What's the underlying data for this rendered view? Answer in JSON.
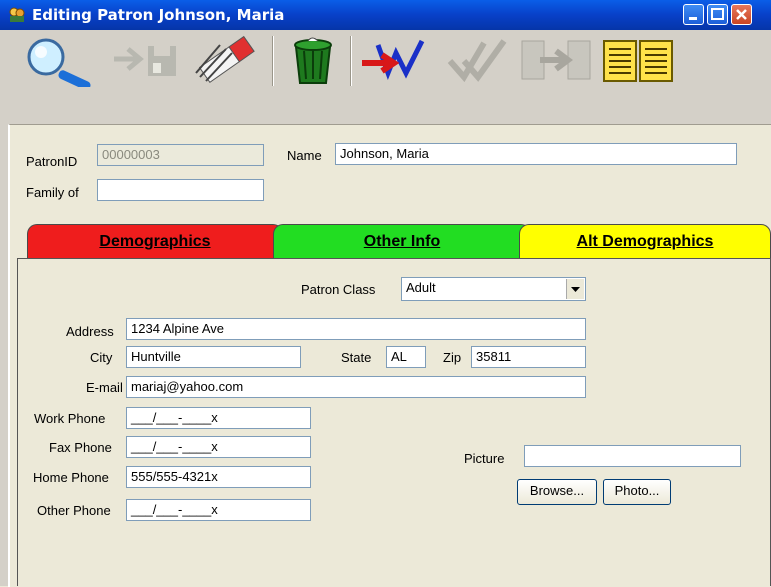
{
  "window": {
    "title": "Editing Patron Johnson, Maria"
  },
  "toolbar": {
    "buttons": [
      "search-icon",
      "save-exit-icon",
      "erase-icon",
      "trash-icon",
      "return-icon",
      "check-icon",
      "transfer-icon",
      "report-icon"
    ]
  },
  "header": {
    "patron_id_label": "PatronID",
    "patron_id_value": "00000003",
    "name_label": "Name",
    "name_value": "Johnson, Maria",
    "family_label": "Family of",
    "family_value": ""
  },
  "tabs": [
    {
      "label": "Demographics",
      "color": "#ef1d1d"
    },
    {
      "label": "Other Info",
      "color": "#22dd22"
    },
    {
      "label": "Alt Demographics",
      "color": "#ffff00"
    }
  ],
  "demographics": {
    "patron_class_label": "Patron Class",
    "patron_class_value": "Adult",
    "address_label": "Address",
    "address_value": "1234 Alpine Ave",
    "city_label": "City",
    "city_value": "Huntville",
    "state_label": "State",
    "state_value": "AL",
    "zip_label": "Zip",
    "zip_value": "35811",
    "email_label": "E-mail",
    "email_value": "mariaj@yahoo.com",
    "work_phone_label": "Work Phone",
    "work_phone_value": "___/___-____x",
    "fax_phone_label": "Fax Phone",
    "fax_phone_value": "___/___-____x",
    "home_phone_label": "Home Phone",
    "home_phone_value": "555/555-4321x",
    "other_phone_label": "Other Phone",
    "other_phone_value": "___/___-____x",
    "picture_label": "Picture",
    "picture_value": "",
    "browse_label": "Browse...",
    "photo_label": "Photo..."
  }
}
